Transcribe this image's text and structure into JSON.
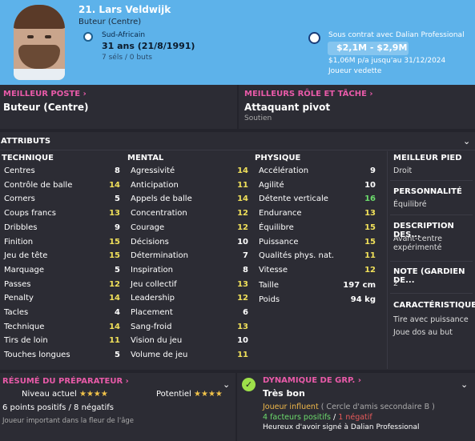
{
  "player": {
    "name": "21. Lars Veldwijk",
    "position": "Buteur (Centre)",
    "nationality": "Sud-Africain",
    "age": "31 ans (21/8/1991)",
    "caps": "7 séls / 0 buts"
  },
  "contract": {
    "club": "Sous contrat avec Dalian Professional",
    "value": "$2,1M - $2,9M",
    "wage": "$1,06M p/a jusqu'au 31/12/2024",
    "status": "Joueur vedette"
  },
  "best_position": {
    "title": "MEILLEUR POSTE",
    "value": "Buteur (Centre)"
  },
  "best_role": {
    "title": "MEILLEURS RÔLE ET TÂCHE",
    "value": "Attaquant pivot",
    "duty": "Soutien"
  },
  "attributes": {
    "title": "ATTRIBUTS",
    "technical": {
      "title": "TECHNIQUE",
      "items": [
        [
          "Centres",
          "8"
        ],
        [
          "Contrôle de balle",
          "14"
        ],
        [
          "Corners",
          "5"
        ],
        [
          "Coups francs",
          "13"
        ],
        [
          "Dribbles",
          "9"
        ],
        [
          "Finition",
          "15"
        ],
        [
          "Jeu de tête",
          "15"
        ],
        [
          "Marquage",
          "5"
        ],
        [
          "Passes",
          "12"
        ],
        [
          "Penalty",
          "14"
        ],
        [
          "Tacles",
          "4"
        ],
        [
          "Technique",
          "14"
        ],
        [
          "Tirs de loin",
          "11"
        ],
        [
          "Touches longues",
          "5"
        ]
      ]
    },
    "mental": {
      "title": "MENTAL",
      "items": [
        [
          "Agressivité",
          "14"
        ],
        [
          "Anticipation",
          "11"
        ],
        [
          "Appels de balle",
          "14"
        ],
        [
          "Concentration",
          "12"
        ],
        [
          "Courage",
          "12"
        ],
        [
          "Décisions",
          "10"
        ],
        [
          "Détermination",
          "7"
        ],
        [
          "Inspiration",
          "8"
        ],
        [
          "Jeu collectif",
          "13"
        ],
        [
          "Leadership",
          "12"
        ],
        [
          "Placement",
          "6"
        ],
        [
          "Sang-froid",
          "13"
        ],
        [
          "Vision du jeu",
          "10"
        ],
        [
          "Volume de jeu",
          "11"
        ]
      ]
    },
    "physical": {
      "title": "PHYSIQUE",
      "items": [
        [
          "Accélération",
          "9"
        ],
        [
          "Agilité",
          "10"
        ],
        [
          "Détente verticale",
          "16"
        ],
        [
          "Endurance",
          "13"
        ],
        [
          "Équilibre",
          "15"
        ],
        [
          "Puissance",
          "15"
        ],
        [
          "Qualités phys. nat.",
          "11"
        ],
        [
          "Vitesse",
          "12"
        ]
      ],
      "height_label": "Taille",
      "height": "197 cm",
      "weight_label": "Poids",
      "weight": "94 kg"
    }
  },
  "side": {
    "foot_t": "MEILLEUR PIED",
    "foot": "Droit",
    "pers_t": "PERSONNALITÉ",
    "pers": "Équilibré",
    "desc_t": "DESCRIPTION DES...",
    "desc": "Avant-centre expérimenté",
    "gk_t": "NOTE (GARDIEN DE...",
    "gk": "2",
    "traits_t": "CARACTÉRISTIQUE...",
    "trait1": "Tire avec puissance",
    "trait2": "Joue dos au but"
  },
  "coach": {
    "title": "RÉSUMÉ DU PRÉPARATEUR",
    "current_label": "Niveau actuel",
    "current_stars": 4,
    "potential_label": "Potentiel",
    "potential_stars": 4,
    "pos_neg": "6 points positifs / 8 négatifs",
    "comment": "Joueur important dans la fleur de l'âge"
  },
  "dynamics": {
    "title": "DYNAMIQUE DE GRP.",
    "status": "Très bon",
    "influence": "Joueur influent",
    "circle": " ( Cercle d'amis secondaire B )",
    "positive": "4 facteurs positifs",
    "slash": " / ",
    "negative": "1 négatif",
    "note": "Heureux d'avoir signé à Dalian Professional"
  },
  "colors": {
    "accent": "#e85aa8",
    "yellow": "#f0e05a",
    "green": "#6cdc6c",
    "header": "#5db2ea"
  }
}
